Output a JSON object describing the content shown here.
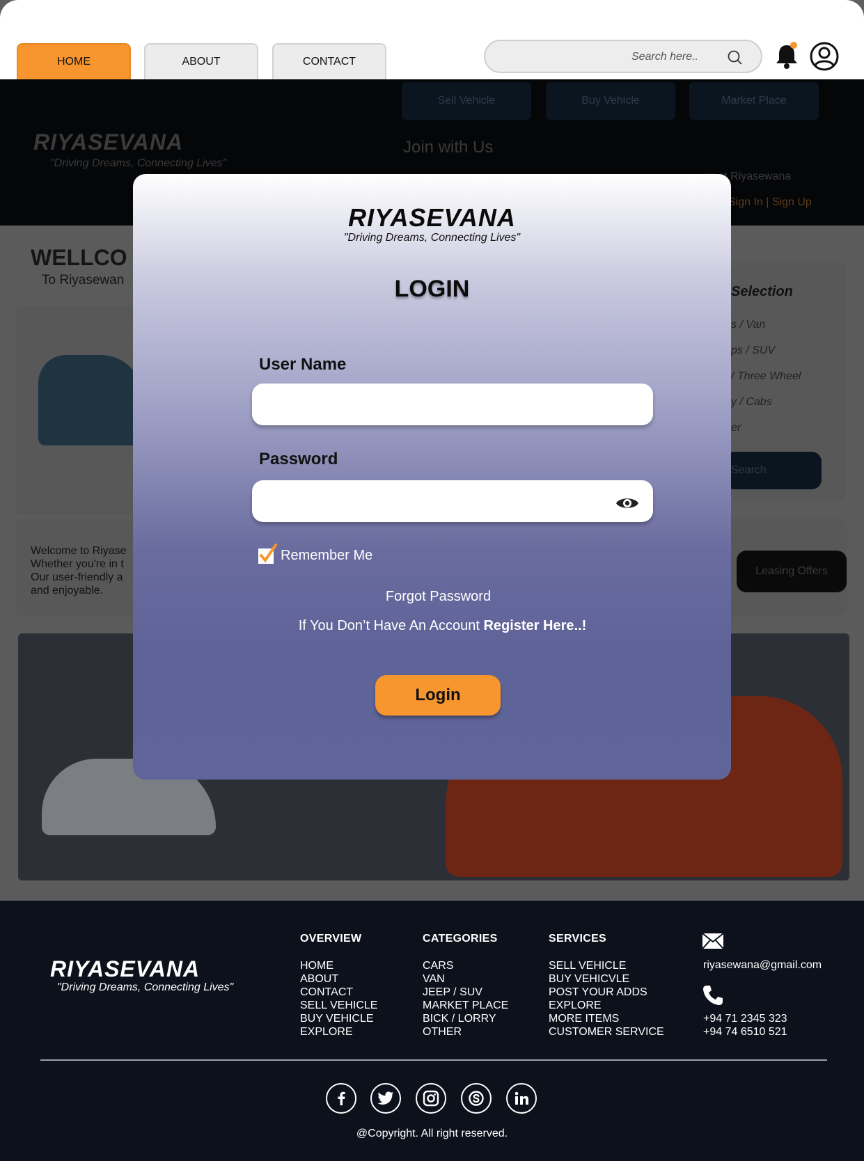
{
  "nav": {
    "tabs": [
      "HOME",
      "ABOUT",
      "CONTACT"
    ],
    "search_placeholder": "Search here.."
  },
  "background": {
    "logo": "RIYASEVANA",
    "tagline": "\"Driving Dreams, Connecting Lives\"",
    "buttons": [
      "Sell Vehicle",
      "Buy Vehicle",
      "Market Place"
    ],
    "join": "Join with Us",
    "join_line": "us at Riyasewana",
    "sign_in": "Sign In",
    "sign_up": "Sign Up",
    "welcome": "WELLCO",
    "to": "To Riyasewan",
    "text_lines": [
      "Welcome to Riyase",
      "Whether you're in t",
      "Our user-friendly a",
      "and enjoyable."
    ],
    "selection_title": "Selection",
    "selection_items": [
      "s / Van",
      "ps / SUV",
      "/ Three Wheel",
      "y / Cabs",
      "er"
    ],
    "search_btn": "Search",
    "leasing": "Leasing Offers"
  },
  "modal": {
    "logo": "RIYASEVANA",
    "tagline": "\"Driving Dreams, Connecting Lives\"",
    "title": "LOGIN",
    "username_label": "User Name",
    "username_value": "",
    "password_label": "Password",
    "password_value": "",
    "remember_label": "Remember Me",
    "remember_checked": true,
    "forgot": "Forgot Password",
    "register_prefix": "If You Don’t Have An Account",
    "register_link": "Register Here..!",
    "login_button": "Login",
    "accent": "#f7962e"
  },
  "footer": {
    "logo": "RIYASEVANA",
    "tagline": "\"Driving Dreams, Connecting Lives\"",
    "columns": [
      {
        "title": "OVERVIEW",
        "items": [
          "HOME",
          "ABOUT",
          "CONTACT",
          "SELL VEHICLE",
          "BUY VEHICLE",
          "EXPLORE"
        ]
      },
      {
        "title": "CATEGORIES",
        "items": [
          "CARS",
          "VAN",
          "JEEP / SUV",
          "MARKET PLACE",
          "BICK / LORRY",
          "OTHER"
        ]
      },
      {
        "title": "SERVICES",
        "items": [
          "SELL VEHICLE",
          "BUY VEHICVLE",
          "POST YOUR ADDS",
          "EXPLORE",
          "MORE ITEMS",
          "CUSTOMER SERVICE"
        ]
      }
    ],
    "email": "riyasewana@gmail.com",
    "phones": [
      "+94 71 2345 323",
      "+94 74 6510 521"
    ],
    "social_icons": [
      "facebook-icon",
      "twitter-icon",
      "instagram-icon",
      "skype-icon",
      "linkedin-icon"
    ],
    "copyright": "@Copyright. All right reserved."
  }
}
